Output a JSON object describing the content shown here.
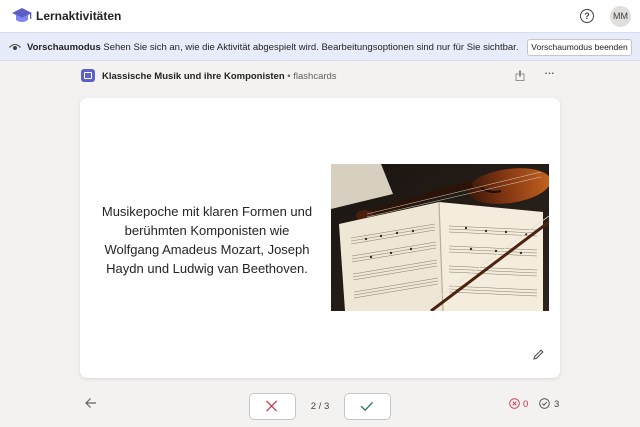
{
  "app": {
    "title": "Lernaktivitäten",
    "help_label": "?",
    "avatar_initials": "MM"
  },
  "preview": {
    "label": "Vorschaumodus",
    "message": "Sehen Sie sich an, wie die Aktivität abgespielt wird. Bearbeitungsoptionen sind nur für Sie sichtbar.",
    "exit_label": "Vorschaumodus beenden"
  },
  "deck": {
    "title": "Klassische Musik und ihre Komponisten",
    "kind": "• flashcards",
    "more_label": "···"
  },
  "card": {
    "text": "Musikepoche mit klaren Formen und berühmten Komponisten wie Wolfgang Amadeus Mozart, Joseph Haydn und Ludwig van Beethoven.",
    "image": "violin-on-sheet-music"
  },
  "navigation": {
    "progress": "2 / 3",
    "wrong_count": "0",
    "right_count": "3"
  },
  "colors": {
    "accent": "#5b5fc7",
    "preview_bar": "#e8ebfa",
    "wrong": "#c4314b",
    "right": "#237b4b"
  },
  "icons": [
    "graduation-cap-icon",
    "eye-icon",
    "deck-icon",
    "share-icon",
    "edit-icon",
    "arrow-left-icon",
    "close-icon",
    "checkmark-icon",
    "wrong-circle-icon",
    "check-circle-icon"
  ]
}
